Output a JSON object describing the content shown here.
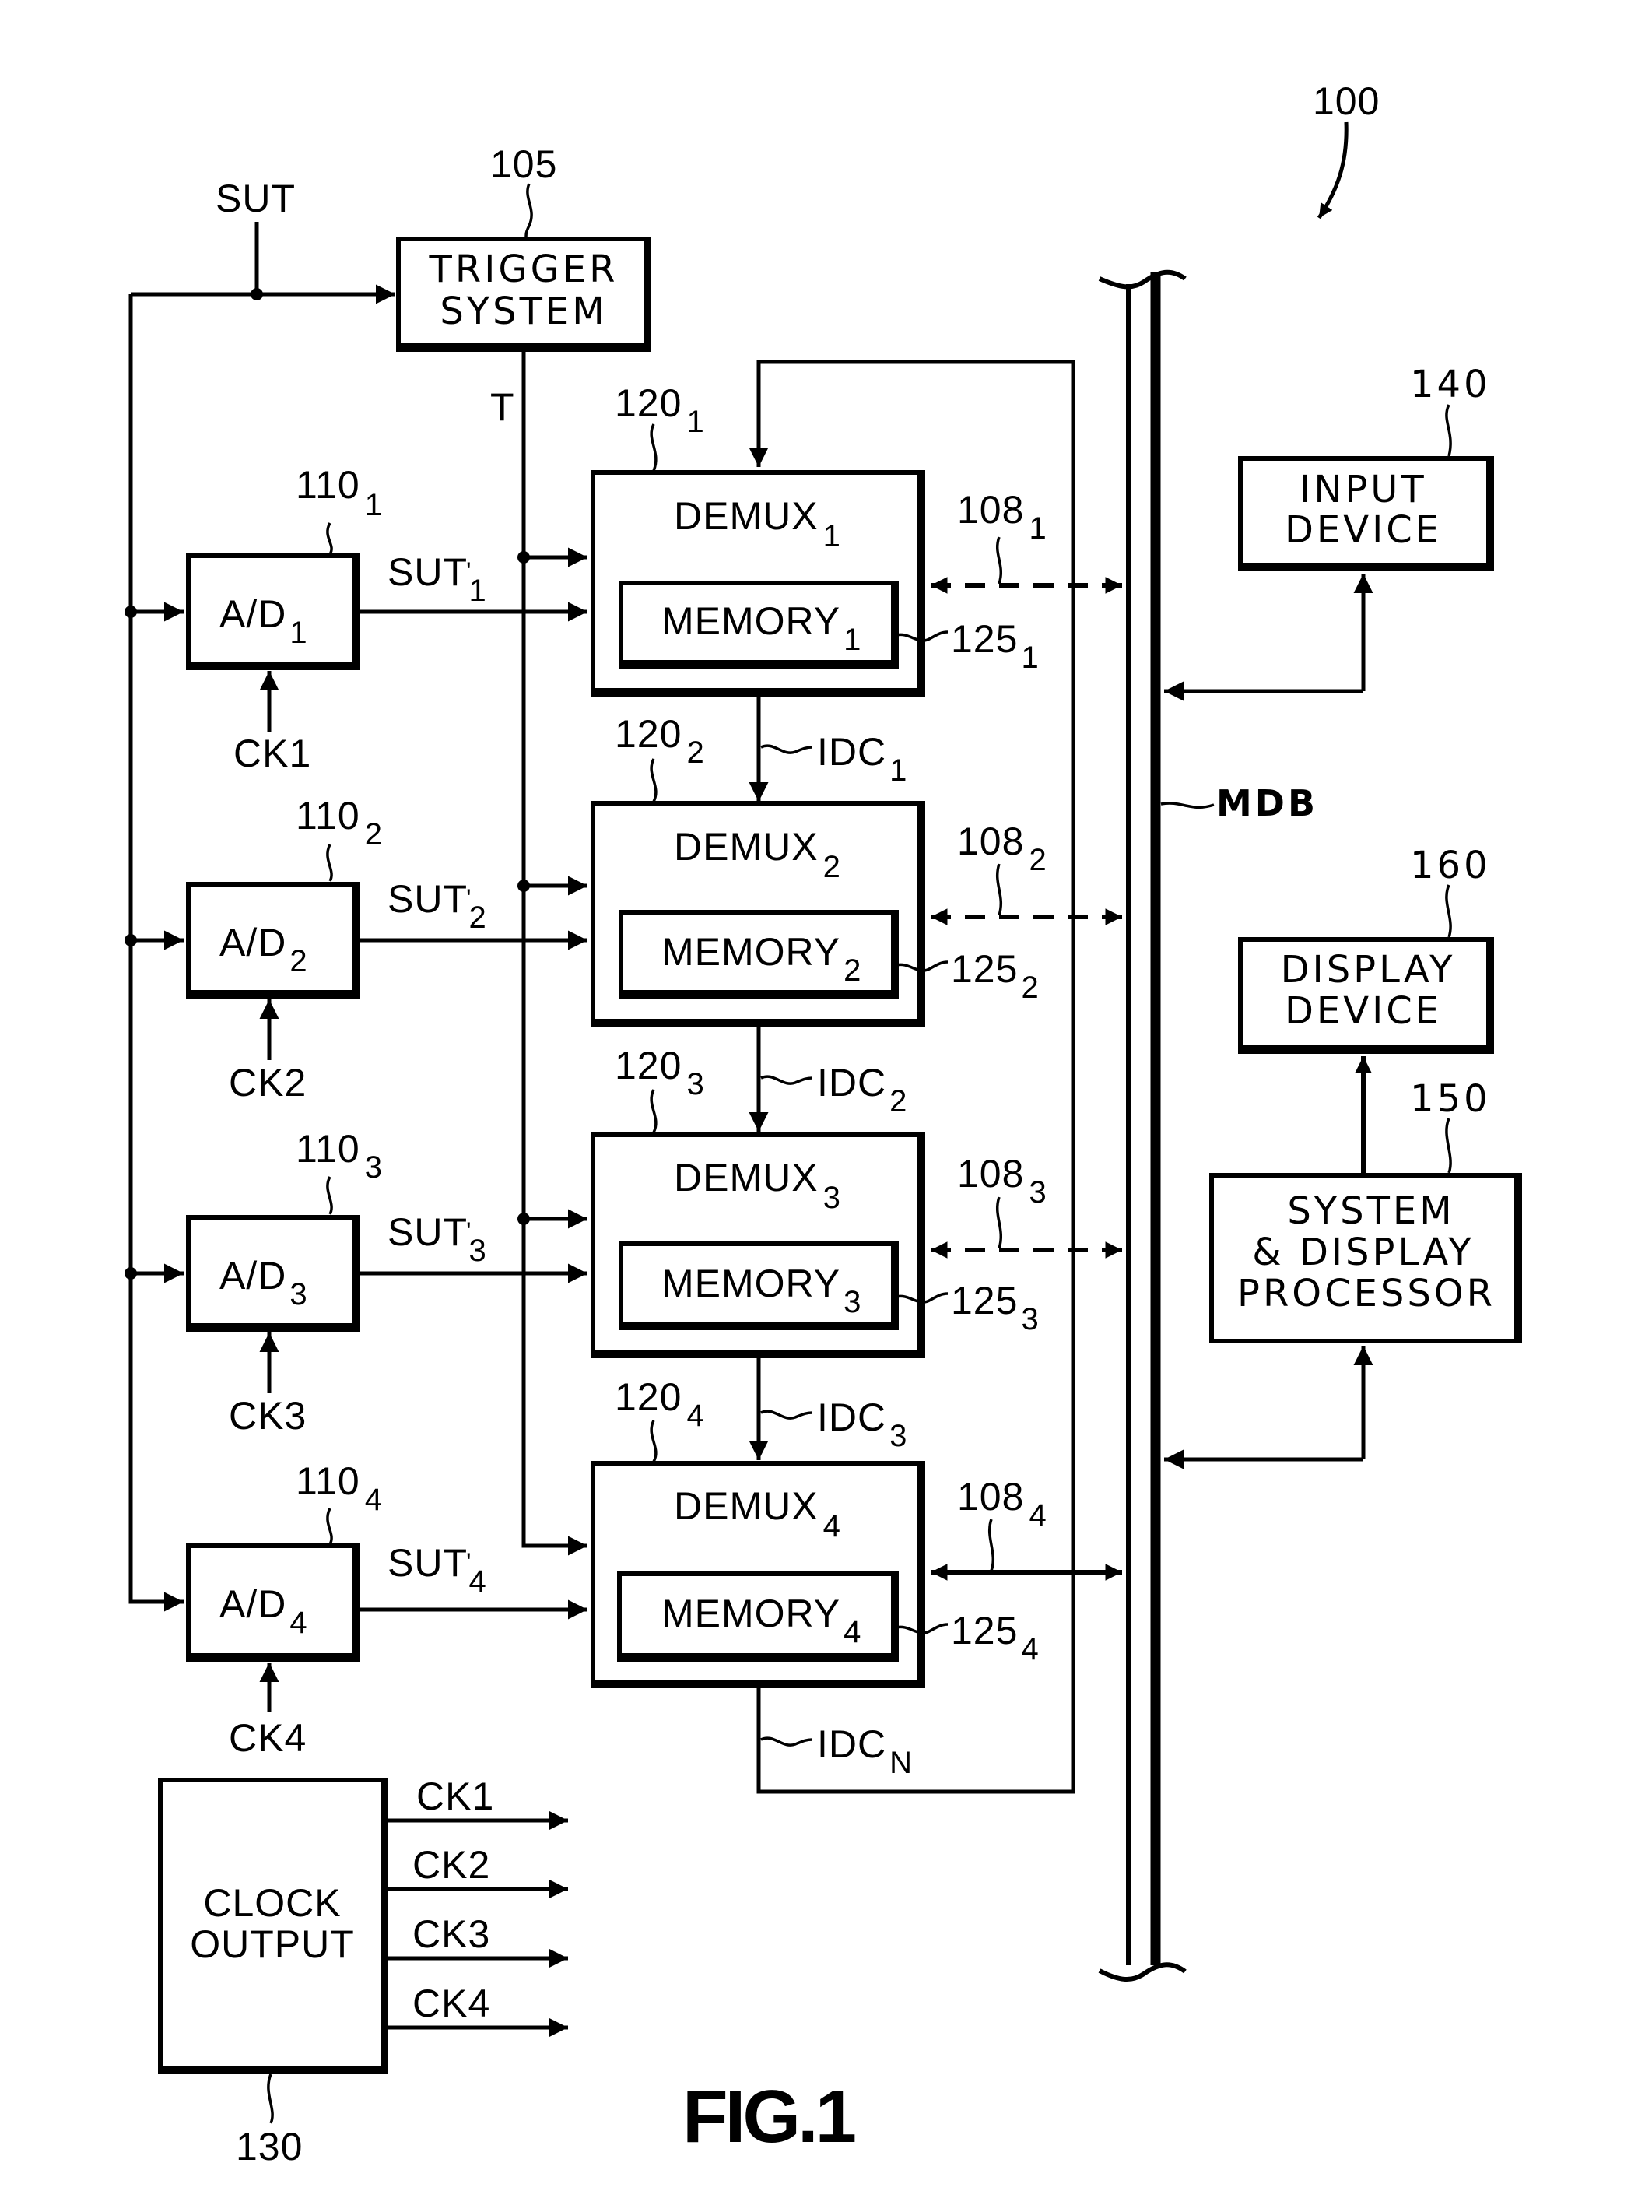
{
  "figure": {
    "title": "FIG.1",
    "system_ref": "100"
  },
  "signals": {
    "input": "SUT",
    "trigger": "T",
    "bus": "MDB"
  },
  "trigger_system": {
    "ref": "105",
    "line1": "TRIGGER",
    "line2": "SYSTEM"
  },
  "channels": [
    {
      "ad_ref": "110",
      "ad_sub": "1",
      "ad_label": "A/D",
      "clock": "CK1",
      "sut_label": "SUT",
      "sut_sub": "1",
      "demux_ref": "120",
      "demux_sub": "1",
      "demux_label": "DEMUX",
      "memory_ref": "125",
      "memory_label": "MEMORY",
      "bus_ref": "108",
      "idc_label": "IDC",
      "idc_sub": "1",
      "bus_link": "dashed"
    },
    {
      "ad_ref": "110",
      "ad_sub": "2",
      "ad_label": "A/D",
      "clock": "CK2",
      "sut_label": "SUT",
      "sut_sub": "2",
      "demux_ref": "120",
      "demux_sub": "2",
      "demux_label": "DEMUX",
      "memory_ref": "125",
      "memory_label": "MEMORY",
      "bus_ref": "108",
      "idc_label": "IDC",
      "idc_sub": "2",
      "bus_link": "dashed"
    },
    {
      "ad_ref": "110",
      "ad_sub": "3",
      "ad_label": "A/D",
      "clock": "CK3",
      "sut_label": "SUT",
      "sut_sub": "3",
      "demux_ref": "120",
      "demux_sub": "3",
      "demux_label": "DEMUX",
      "memory_ref": "125",
      "memory_label": "MEMORY",
      "bus_ref": "108",
      "idc_label": "IDC",
      "idc_sub": "3",
      "bus_link": "dashed"
    },
    {
      "ad_ref": "110",
      "ad_sub": "4",
      "ad_label": "A/D",
      "clock": "CK4",
      "sut_label": "SUT",
      "sut_sub": "4",
      "demux_ref": "120",
      "demux_sub": "4",
      "demux_label": "DEMUX",
      "memory_ref": "125",
      "memory_label": "MEMORY",
      "bus_ref": "108",
      "idc_label": "IDC",
      "idc_sub": "N",
      "bus_link": "solid"
    }
  ],
  "clock_output": {
    "ref": "130",
    "line1": "CLOCK",
    "line2": "OUTPUT",
    "outputs": [
      "CK1",
      "CK2",
      "CK3",
      "CK4"
    ]
  },
  "input_device": {
    "ref": "140",
    "line1": "INPUT",
    "line2": "DEVICE"
  },
  "processor": {
    "ref": "150",
    "line1": "SYSTEM",
    "line2": "& DISPLAY",
    "line3": "PROCESSOR"
  },
  "display_device": {
    "ref": "160",
    "line1": "DISPLAY",
    "line2": "DEVICE"
  }
}
